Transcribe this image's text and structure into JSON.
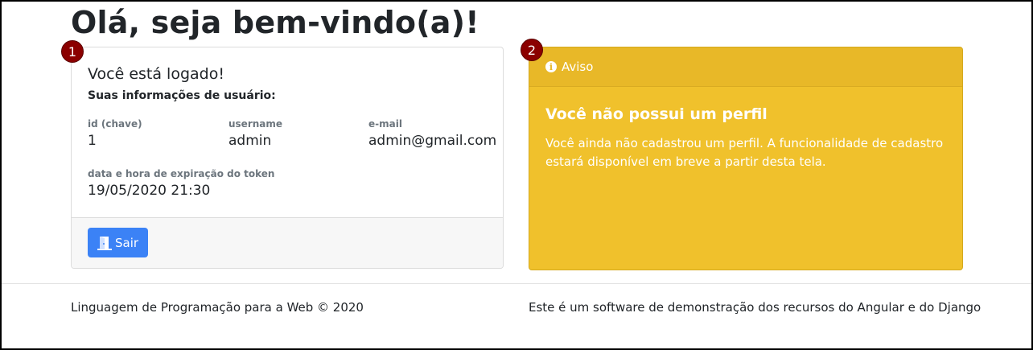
{
  "page": {
    "title": "Olá, seja bem-vindo(a)!"
  },
  "badges": [
    "1",
    "2"
  ],
  "user_card": {
    "title": "Você está logado!",
    "subtitle": "Suas informações de usuário:",
    "fields": {
      "id": {
        "label": "id (chave)",
        "value": "1"
      },
      "username": {
        "label": "username",
        "value": "admin"
      },
      "email": {
        "label": "e-mail",
        "value": "admin@gmail.com"
      },
      "token_expiry": {
        "label": "data e hora de expiração do token",
        "value": "19/05/2020 21:30"
      }
    },
    "logout_button": {
      "label": "Sair",
      "icon": "door-exit-icon"
    }
  },
  "alert": {
    "header": "Aviso",
    "header_icon": "info-icon",
    "title": "Você não possui um perfil",
    "text": "Você ainda não cadastrou um perfil. A funcionalidade de cadastro estará disponível em breve a partir desta tela."
  },
  "footer": {
    "left": "Linguagem de Programação para a Web © 2020",
    "right": "Este é um software de demonstração dos recursos do Angular e do Django"
  },
  "colors": {
    "primary": "#3b82f6",
    "warning": "#f0c12c",
    "badge": "#8b0000"
  }
}
